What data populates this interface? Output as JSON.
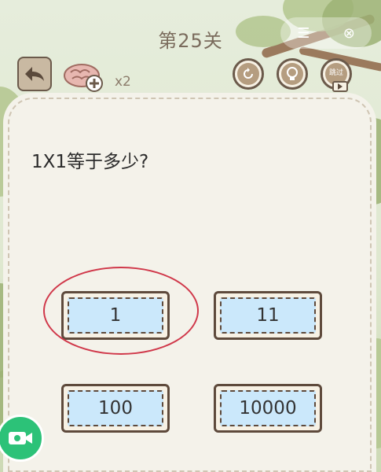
{
  "header": {
    "level_title": "第25关",
    "menu_icon": "menu-icon",
    "close_icon": "close-icon"
  },
  "toolbar": {
    "back_icon": "back-arrow-icon",
    "brain_icon": "brain-plus-icon",
    "brain_count": "x2",
    "refresh_icon": "refresh-icon",
    "hint_icon": "lightbulb-icon",
    "skip_label": "跳过",
    "skip_icon": "play-icon"
  },
  "question": {
    "text": "1X1等于多少?"
  },
  "options": [
    {
      "label": "1",
      "selected": true
    },
    {
      "label": "11",
      "selected": false
    },
    {
      "label": "100",
      "selected": false
    },
    {
      "label": "10000",
      "selected": false
    }
  ],
  "video_button": {
    "icon": "video-camera-icon"
  },
  "colors": {
    "accent_red": "#d0384a",
    "option_fill": "#cbe8fb",
    "video_green": "#2cc278",
    "frame_brown": "#5e4a3c"
  }
}
